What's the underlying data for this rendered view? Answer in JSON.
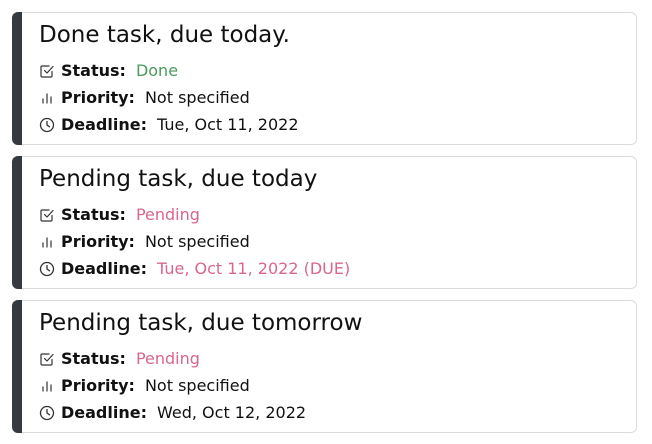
{
  "labels": {
    "status": "Status:",
    "priority": "Priority:",
    "deadline": "Deadline:"
  },
  "colors": {
    "accent_bar": "#343a40",
    "done": "#4a9a5c",
    "pending": "#d9668f",
    "border": "#dcdcdc"
  },
  "icons": {
    "status": "checkbox-check-icon",
    "priority": "bar-chart-icon",
    "deadline": "clock-icon"
  },
  "tasks": [
    {
      "title": "Done task, due today.",
      "status": "Done",
      "priority": "Not specified",
      "deadline": "Tue, Oct 11, 2022"
    },
    {
      "title": "Pending task, due today",
      "status": "Pending",
      "priority": "Not specified",
      "deadline": "Tue, Oct 11, 2022 (DUE)"
    },
    {
      "title": "Pending task, due tomorrow",
      "status": "Pending",
      "priority": "Not specified",
      "deadline": "Wed, Oct 12, 2022"
    }
  ]
}
